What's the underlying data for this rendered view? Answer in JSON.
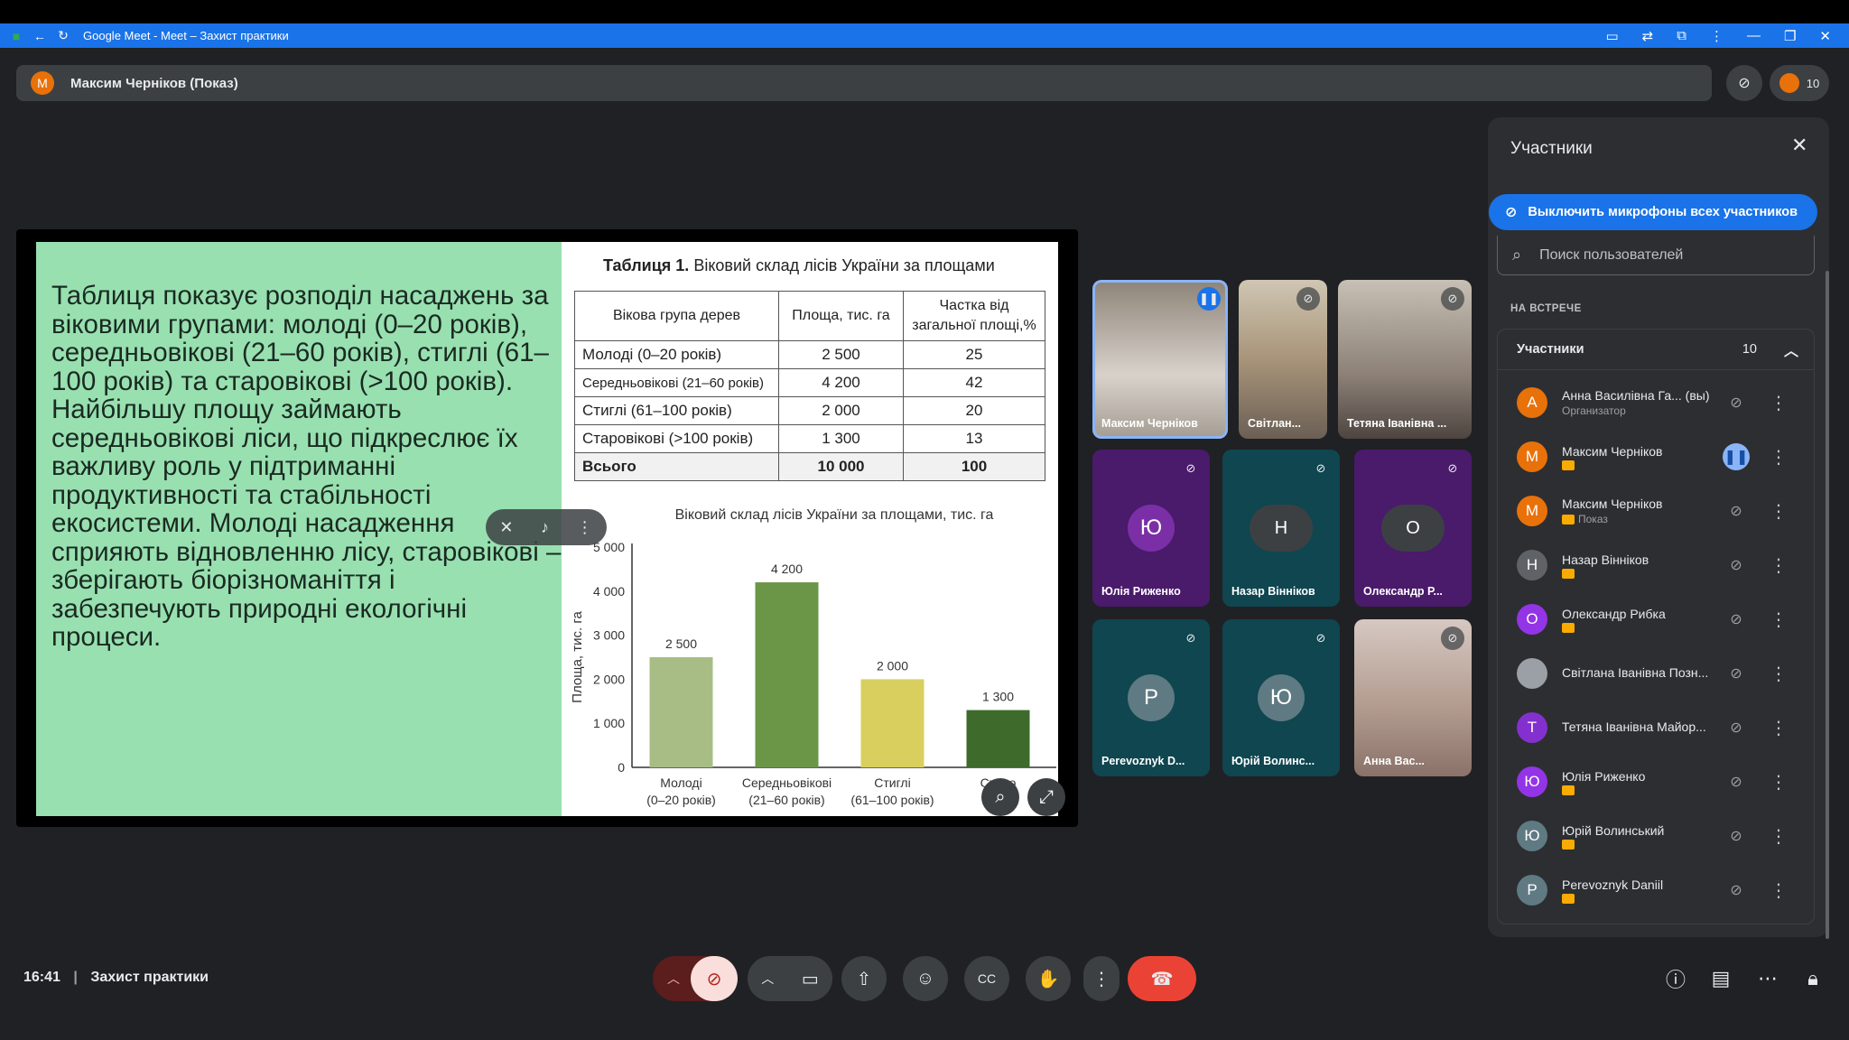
{
  "browser": {
    "title": "Google Meet - Meet – Захист практики"
  },
  "presenter_bar": {
    "avatar_letter": "М",
    "text": "Максим Черніков (Показ)",
    "participant_count": "10"
  },
  "slide": {
    "text": "Таблиця показує розподіл насаджень за віковими групами: молоді (0–20 років), середньовікові (21–60 років), стиглі (61–100 років) та старовікові (>100 років). Найбільшу площу займають середньовікові ліси, що підкреслює їх важливу роль у підтриманні продуктивності та стабільності екосистеми. Молоді насадження сприяють відновленню лісу, старовікові – зберігають біорізноманіття і забезпечують природні екологічні процеси.",
    "table_title_bold": "Таблиця 1.",
    "table_title": "Віковий склад лісів України за площами",
    "table_headers": [
      "Вікова група дерев",
      "Площа, тис. га",
      "Частка від загальної площі,%"
    ],
    "table_rows": [
      [
        "Молоді (0–20 років)",
        "2 500",
        "25"
      ],
      [
        "Середньовікові (21–60 років)",
        "4 200",
        "42"
      ],
      [
        "Стиглі (61–100 років)",
        "2 000",
        "20"
      ],
      [
        "Старовікові (>100 років)",
        "1 300",
        "13"
      ],
      [
        "Всього",
        "10 000",
        "100"
      ]
    ]
  },
  "chart_data": {
    "type": "bar",
    "title": "Віковий склад лісів України за площами, тис. га",
    "ylabel": "Площа, тис. га",
    "categories": [
      "Молоді (0–20 років)",
      "Середньовікові (21–60 років)",
      "Стиглі (61–100 років)",
      "Старо... (>100..."
    ],
    "category_lines": [
      [
        "Молоді",
        "(0–20 років)"
      ],
      [
        "Середньовікові",
        "(21–60 років)"
      ],
      [
        "Стиглі",
        "(61–100 років)"
      ],
      [
        "Старо",
        "(>100"
      ]
    ],
    "values": [
      2500,
      4200,
      2000,
      1300
    ],
    "value_labels": [
      "2 500",
      "4 200",
      "2 000",
      "1 300"
    ],
    "colors": [
      "#a8bd85",
      "#6b9648",
      "#d8cf5e",
      "#3e6a2b"
    ],
    "ylim": [
      0,
      5000
    ],
    "yticks": [
      "0",
      "1 000",
      "2 000",
      "3 000",
      "4 000",
      "5 000"
    ],
    "grid": false
  },
  "tiles": [
    {
      "name": "Максим Черніков",
      "kind": "video",
      "color": "#6d6660"
    },
    {
      "name": "Світлан...",
      "kind": "video",
      "color": "#8a7d6c"
    },
    {
      "name": "Тетяна Іванівна ...",
      "kind": "video",
      "color": "#7a7268"
    },
    {
      "name": "Юлія Риженко",
      "kind": "avatar",
      "letter": "Ю",
      "color": "#4a1a6b",
      "avatar_color": "#7b2fa6"
    },
    {
      "name": "Назар Вінніков",
      "kind": "avatar",
      "letter": "Н",
      "color": "#0f4650",
      "avatar_color": "#3c4043"
    },
    {
      "name": "Олександр Р...",
      "kind": "avatar",
      "letter": "О",
      "color": "#4a1a6b",
      "avatar_color": "#3c4043"
    },
    {
      "name": "Perevoznyk D...",
      "kind": "avatar",
      "letter": "P",
      "color": "#0f4650",
      "avatar_color": "#5f7a83"
    },
    {
      "name": "Юрій Волинс...",
      "kind": "avatar",
      "letter": "Ю",
      "color": "#0f4650",
      "avatar_color": "#5f7a83"
    },
    {
      "name": "Анна Вас...",
      "kind": "video",
      "color": "#b59e94"
    }
  ],
  "panel": {
    "title": "Участники",
    "mute_all": "Выключить микрофоны всех участников",
    "search_placeholder": "Поиск пользователей",
    "section": "НА ВСТРЕЧЕ",
    "group_title": "Участники",
    "group_count": "10",
    "participants": [
      {
        "letter": "А",
        "color": "#e8710a",
        "name": "Анна Василівна Га... (вы)",
        "sub": "Организатор"
      },
      {
        "letter": "М",
        "color": "#e8710a",
        "name": "Максим Черніков",
        "sub": ""
      },
      {
        "letter": "М",
        "color": "#e8710a",
        "name": "Максим Черніков",
        "sub": "Показ"
      },
      {
        "letter": "Н",
        "color": "#5f6368",
        "name": "Назар Вінніков",
        "sub": ""
      },
      {
        "letter": "О",
        "color": "#9334e6",
        "name": "Олександр Рибка",
        "sub": ""
      },
      {
        "letter": "",
        "color": "#9aa0a6",
        "name": "Світлана Іванівна Позн...",
        "sub": ""
      },
      {
        "letter": "Т",
        "color": "#8430ce",
        "name": "Тетяна Іванівна Майор...",
        "sub": ""
      },
      {
        "letter": "Ю",
        "color": "#9334e6",
        "name": "Юлія Риженко",
        "sub": ""
      },
      {
        "letter": "Ю",
        "color": "#5f7a83",
        "name": "Юрій Волинський",
        "sub": ""
      },
      {
        "letter": "P",
        "color": "#5f7a83",
        "name": "Perevoznyk Daniil",
        "sub": ""
      }
    ]
  },
  "bottom": {
    "time": "16:41",
    "meeting": "Захист практики"
  }
}
